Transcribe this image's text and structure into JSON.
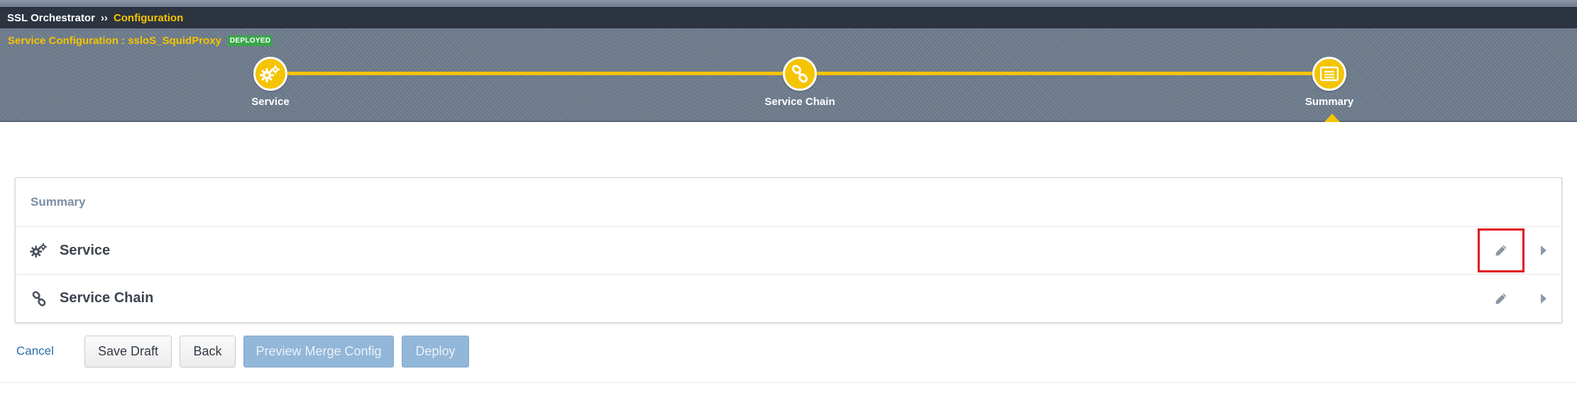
{
  "breadcrumb": {
    "root": "SSL Orchestrator",
    "separator": "››",
    "current": "Configuration"
  },
  "header": {
    "service_configuration": "Service Configuration : ssloS_SquidProxy",
    "status_badge": "DEPLOYED"
  },
  "wizard": {
    "steps": [
      {
        "label": "Service",
        "icon": "gears-icon"
      },
      {
        "label": "Service Chain",
        "icon": "link-icon"
      },
      {
        "label": "Summary",
        "icon": "summary-list-icon",
        "current": true
      }
    ]
  },
  "summary": {
    "title": "Summary",
    "rows": [
      {
        "label": "Service",
        "icon": "gears-icon",
        "edit_icon": "pencil-icon",
        "expand_icon": "caret-right-icon",
        "edit_highlighted": true
      },
      {
        "label": "Service Chain",
        "icon": "link-icon",
        "edit_icon": "pencil-icon",
        "expand_icon": "caret-right-icon",
        "edit_highlighted": false
      }
    ]
  },
  "actions": {
    "cancel": "Cancel",
    "save_draft": "Save Draft",
    "back": "Back",
    "preview_merge_config": "Preview Merge Config",
    "deploy": "Deploy"
  },
  "colors": {
    "accent": "#f5c400",
    "breadcrumb_bg": "#2c3440",
    "header_bg": "#6d7b8c",
    "deployed_badge": "#3aa54a",
    "highlight_border": "#e2141b",
    "disabled_button": "#92b7d9",
    "link": "#2e6da4"
  }
}
